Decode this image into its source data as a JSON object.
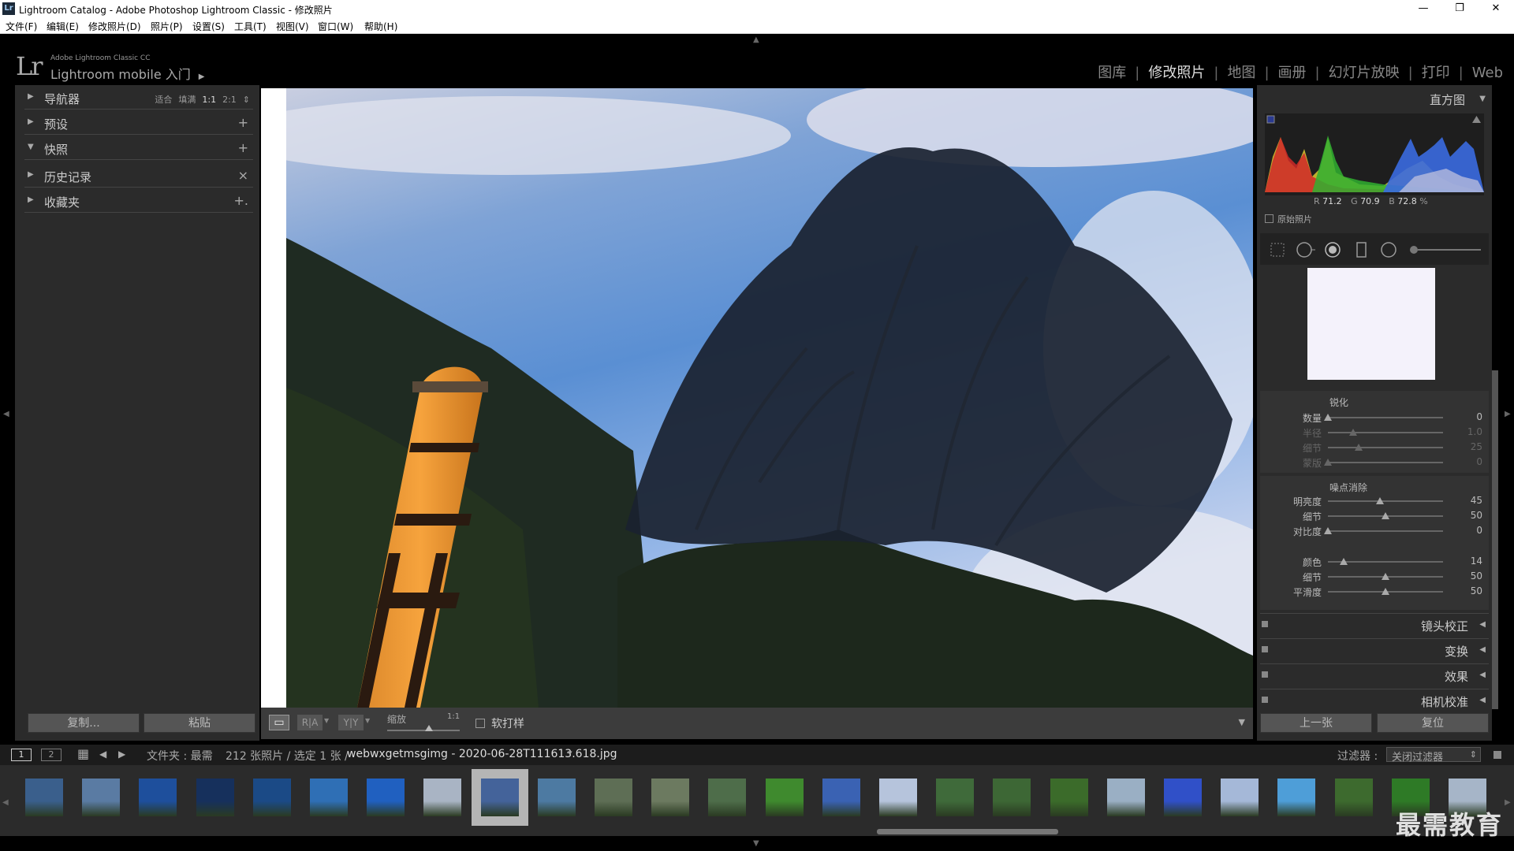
{
  "window": {
    "title": "Lightroom Catalog - Adobe Photoshop Lightroom Classic - 修改照片",
    "app_icon": "Lr",
    "minimize": "—",
    "restore": "❐",
    "close": "✕"
  },
  "menu": [
    "文件(F)",
    "编辑(E)",
    "修改照片(D)",
    "照片(P)",
    "设置(S)",
    "工具(T)",
    "视图(V)",
    "窗口(W)",
    "帮助(H)"
  ],
  "identity": {
    "logo": "Lr",
    "product": "Adobe Lightroom Classic CC",
    "mobile": "Lightroom mobile 入门",
    "arrow": "▶"
  },
  "modules": [
    {
      "label": "图库",
      "active": false
    },
    {
      "label": "修改照片",
      "active": true
    },
    {
      "label": "地图",
      "active": false
    },
    {
      "label": "画册",
      "active": false
    },
    {
      "label": "幻灯片放映",
      "active": false
    },
    {
      "label": "打印",
      "active": false
    },
    {
      "label": "Web",
      "active": false
    }
  ],
  "left_panel": {
    "navigator": {
      "label": "导航器",
      "options": [
        "适合",
        "填满",
        "1:1",
        "2:1"
      ],
      "selected": "1:1",
      "spin": "⇕"
    },
    "sections": [
      {
        "label": "预设",
        "action": "+",
        "tri": "▶"
      },
      {
        "label": "快照",
        "action": "+",
        "tri": "▼"
      },
      {
        "label": "历史记录",
        "action": "×",
        "tri": "▶"
      },
      {
        "label": "收藏夹",
        "action": "+.",
        "tri": "▶"
      }
    ],
    "copy_button": "复制...",
    "paste_button": "粘贴"
  },
  "toolbar": {
    "view_icon": "▭",
    "ra": "R|A",
    "yy": "Y|Y",
    "zoom_label": "缩放",
    "zoom_value": "1:1",
    "softproof_label": "软打样",
    "menu_arrow": "▼"
  },
  "right_panel": {
    "histogram": {
      "label": "直方图",
      "tri": "▼",
      "r_label": "R",
      "r": "71.2",
      "g_label": "G",
      "g": "70.9",
      "b_label": "B",
      "b": "72.8",
      "pct": "%",
      "original_label": "原始照片"
    },
    "sharpen": {
      "title": "锐化",
      "sliders": [
        {
          "label": "数量",
          "value": "0",
          "pos": 0.0,
          "dim": false
        },
        {
          "label": "半径",
          "value": "1.0",
          "pos": 0.22,
          "dim": true
        },
        {
          "label": "细节",
          "value": "25",
          "pos": 0.27,
          "dim": true
        },
        {
          "label": "蒙版",
          "value": "0",
          "pos": 0.0,
          "dim": true
        }
      ]
    },
    "noise": {
      "title": "噪点消除",
      "sliders": [
        {
          "label": "明亮度",
          "value": "45",
          "pos": 0.45,
          "dim": false
        },
        {
          "label": "细节",
          "value": "50",
          "pos": 0.5,
          "dim": false
        },
        {
          "label": "对比度",
          "value": "0",
          "pos": 0.0,
          "dim": false
        },
        {
          "label": "颜色",
          "value": "14",
          "pos": 0.14,
          "dim": false
        },
        {
          "label": "细节",
          "value": "50",
          "pos": 0.5,
          "dim": false
        },
        {
          "label": "平滑度",
          "value": "50",
          "pos": 0.5,
          "dim": false
        }
      ]
    },
    "collapsed": [
      {
        "label": "镜头校正",
        "tri": "◀"
      },
      {
        "label": "变换",
        "tri": "◀"
      },
      {
        "label": "效果",
        "tri": "◀"
      },
      {
        "label": "相机校准",
        "tri": "◀"
      }
    ],
    "prev_button": "上一张",
    "reset_button": "复位"
  },
  "filterbar": {
    "page1": "1",
    "page2": "2",
    "grid_icon": "▦",
    "back_icon": "◀",
    "fwd_icon": "▶",
    "source": "文件夹 : 最需",
    "count": "212 张照片 / 选定 1 张 /",
    "filename": "webwxgetmsgimg - 2020-06-28T111613.618.jpg",
    "file_arrow": "▾",
    "filter_label": "过滤器 :",
    "filter_value": "关闭过滤器",
    "filter_spin": "⇕"
  },
  "filmstrip": {
    "selected_index": 8,
    "thumbs": [
      "#3a5f8c",
      "#5a7ba3",
      "#1e4f9c",
      "#16305c",
      "#1b4a86",
      "#2f6fb5",
      "#2060c0",
      "#a9b4c4",
      "#44639a",
      "#4d7aa2",
      "#5e6e55",
      "#6c7a60",
      "#4e6d4a",
      "#3f8a2e",
      "#3a62b3",
      "#b6c4dc",
      "#3f6a3a",
      "#3d6735",
      "#3b6b2a",
      "#9aafc4",
      "#3050c8",
      "#a5b8d8",
      "#4e9ed8",
      "#3d6a2e",
      "#2e7a26",
      "#a6b5c8"
    ]
  },
  "watermark": "最需教育"
}
